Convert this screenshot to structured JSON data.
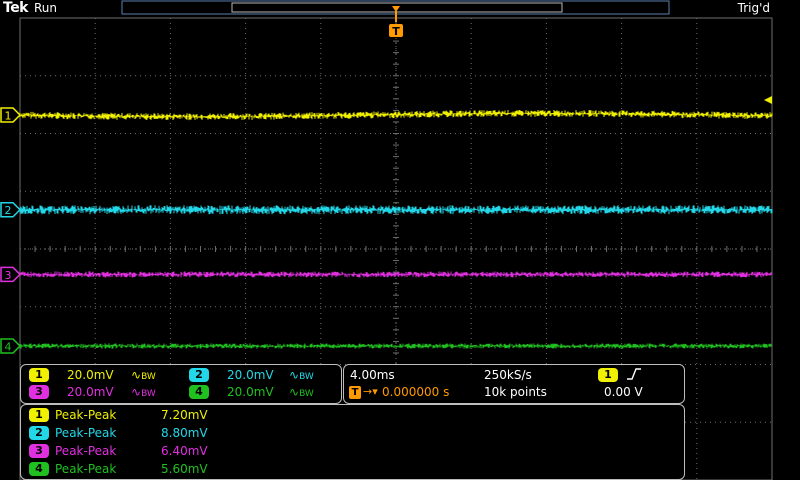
{
  "header": {
    "brand": "Tek",
    "run_state": "Run",
    "trigger_status": "Trig'd",
    "trigger_marker": "T"
  },
  "colors": {
    "ch1": "#f0f000",
    "ch2": "#22d8e8",
    "ch3": "#e030e0",
    "ch4": "#20c020",
    "trigger": "#ff9a00",
    "grid": "#6e6e6e"
  },
  "channels": [
    {
      "id": "1",
      "scale": "20.0mV",
      "bw_label": "BW",
      "measure_label": "Peak-Peak",
      "measure_value": "7.20mV",
      "level_fraction": 0.21
    },
    {
      "id": "2",
      "scale": "20.0mV",
      "bw_label": "BW",
      "measure_label": "Peak-Peak",
      "measure_value": "8.80mV",
      "level_fraction": 0.415
    },
    {
      "id": "3",
      "scale": "20.0mV",
      "bw_label": "BW",
      "measure_label": "Peak-Peak",
      "measure_value": "6.40mV",
      "level_fraction": 0.555
    },
    {
      "id": "4",
      "scale": "20.0mV",
      "bw_label": "BW",
      "measure_label": "Peak-Peak",
      "measure_value": "5.60mV",
      "level_fraction": 0.71
    }
  ],
  "timebase": {
    "scale": "4.00ms",
    "sample_rate": "250kS/s",
    "position": "0.000000 s",
    "record_length": "10k points"
  },
  "trigger": {
    "source": "1",
    "slope_icon": "rising-edge-icon",
    "level": "0.00 V"
  }
}
